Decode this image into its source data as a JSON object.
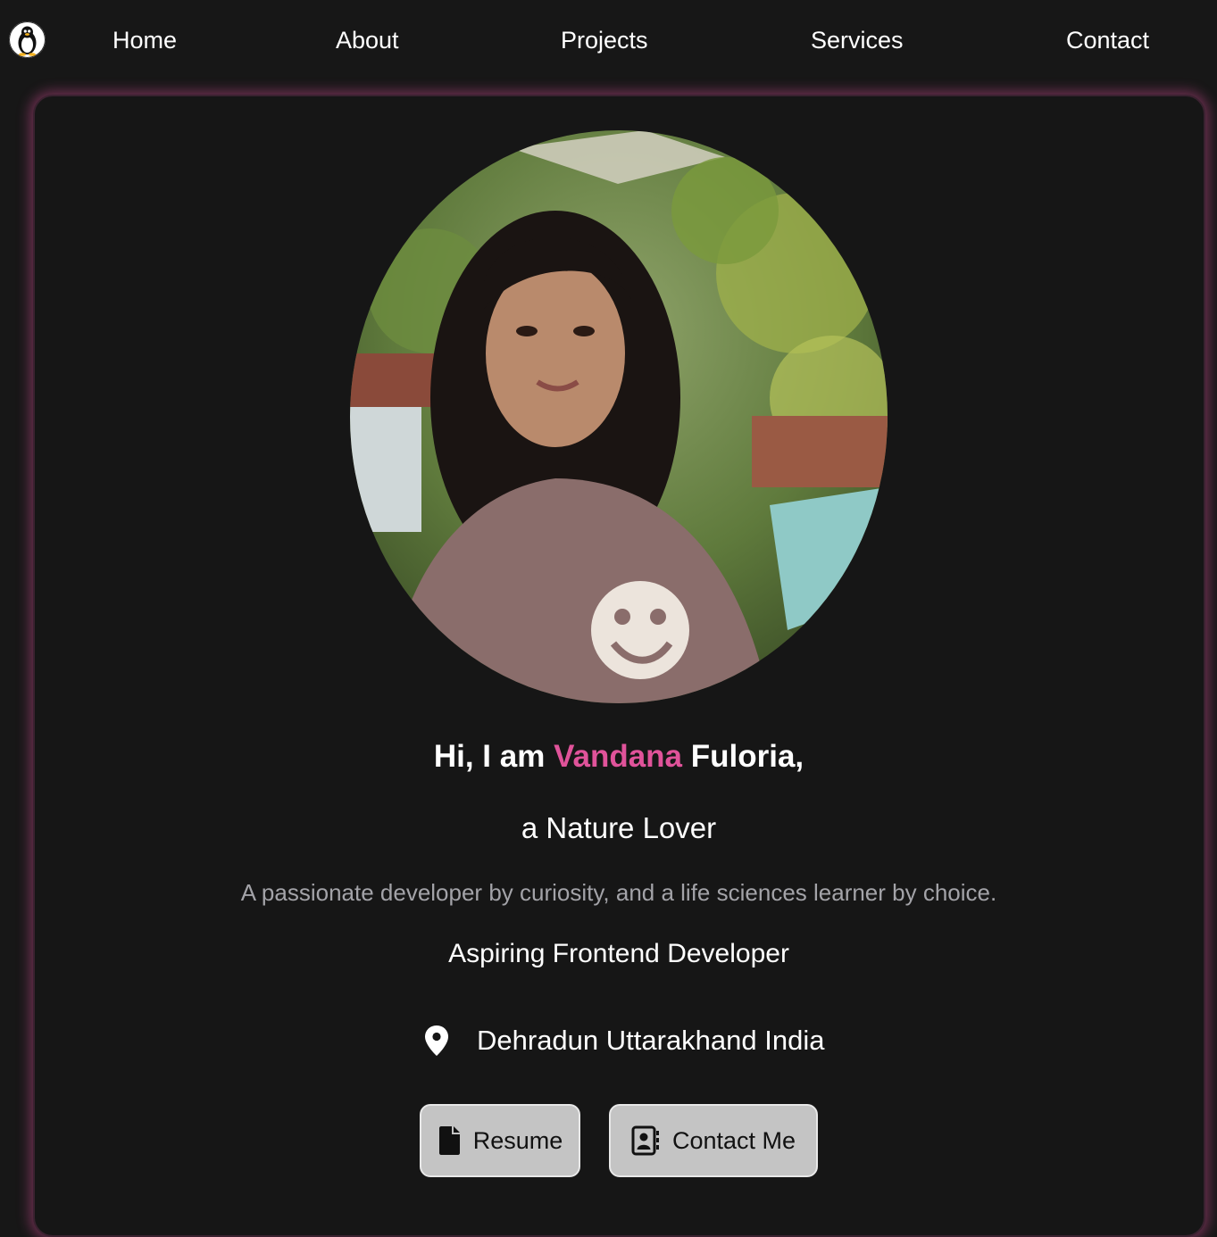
{
  "nav": {
    "logo_icon": "linux-penguin-icon",
    "items": [
      {
        "label": "Home"
      },
      {
        "label": "About"
      },
      {
        "label": "Projects"
      },
      {
        "label": "Services"
      },
      {
        "label": "Contact"
      }
    ]
  },
  "hero": {
    "greeting_prefix": "Hi, I am ",
    "first_name": "Vandana",
    "last_name": " Fuloria,",
    "tagline": "a Nature Lover",
    "description": "A passionate developer by curiosity, and a life sciences learner by choice.",
    "role": "Aspiring Frontend Developer",
    "location": "Dehradun Uttarakhand India",
    "location_icon": "map-pin-icon",
    "buttons": {
      "resume_label": "Resume",
      "resume_icon": "file-icon",
      "contact_label": "Contact Me",
      "contact_icon": "address-book-icon"
    }
  },
  "colors": {
    "background": "#171717",
    "accent": "#e0539a",
    "muted_text": "#a3a3a8",
    "button_bg": "#c4c4c4",
    "card_glow": "#d64d96"
  }
}
